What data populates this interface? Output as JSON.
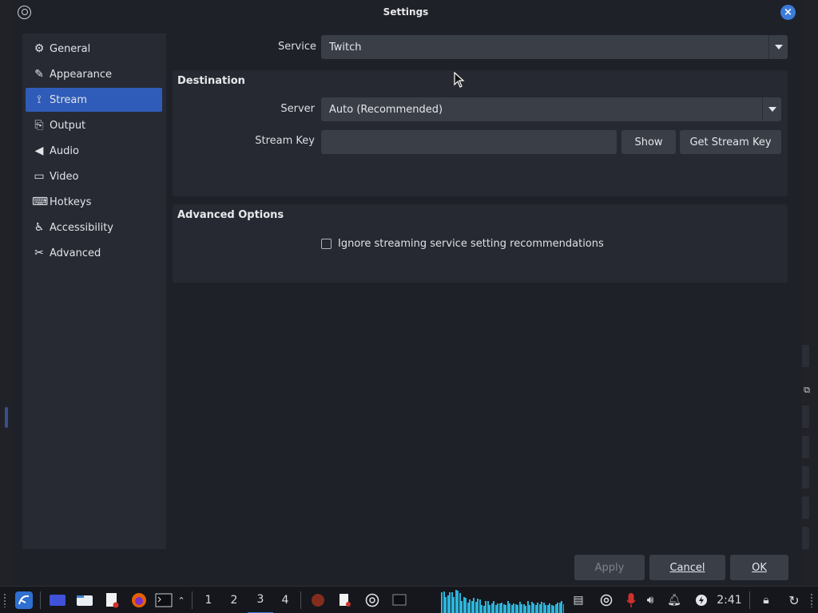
{
  "window": {
    "title": "Settings"
  },
  "sidebar": {
    "items": [
      {
        "label": "General",
        "icon": "gear-icon"
      },
      {
        "label": "Appearance",
        "icon": "appearance-icon"
      },
      {
        "label": "Stream",
        "icon": "antenna-icon",
        "active": true
      },
      {
        "label": "Output",
        "icon": "output-icon"
      },
      {
        "label": "Audio",
        "icon": "speaker-icon"
      },
      {
        "label": "Video",
        "icon": "monitor-icon"
      },
      {
        "label": "Hotkeys",
        "icon": "keyboard-icon"
      },
      {
        "label": "Accessibility",
        "icon": "accessibility-icon"
      },
      {
        "label": "Advanced",
        "icon": "tools-icon"
      }
    ]
  },
  "stream": {
    "service_label": "Service",
    "service_value": "Twitch",
    "destination": {
      "title": "Destination",
      "server_label": "Server",
      "server_value": "Auto (Recommended)",
      "stream_key_label": "Stream Key",
      "stream_key_value": "",
      "show_button": "Show",
      "get_key_button": "Get Stream Key"
    },
    "advanced": {
      "title": "Advanced Options",
      "ignore_recommendations_label": "Ignore streaming service setting recommendations",
      "ignore_recommendations_checked": false
    }
  },
  "footer": {
    "apply": "Apply",
    "cancel": "Cancel",
    "ok": "OK"
  },
  "taskbar": {
    "workspaces": [
      "1",
      "2",
      "3",
      "4"
    ],
    "active_workspace": "3",
    "clock": "2:41"
  },
  "colors": {
    "accent": "#2f5cb8",
    "close_button": "#3d7bd9",
    "audio_viz": "#2ab6dd",
    "mic_active": "#d0312d"
  }
}
